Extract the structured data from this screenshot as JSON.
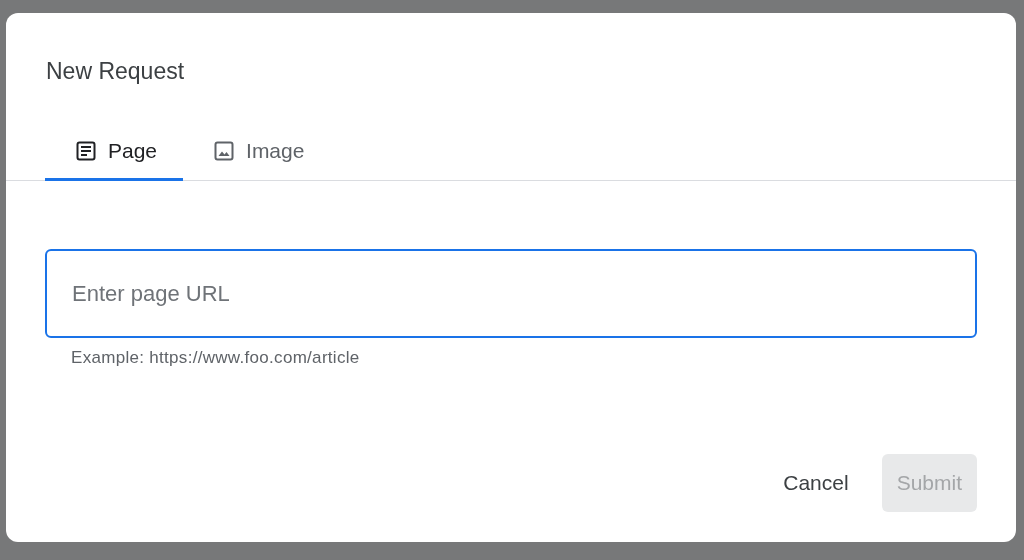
{
  "dialog": {
    "title": "New Request"
  },
  "tabs": [
    {
      "label": "Page",
      "kind": "page",
      "selected": true
    },
    {
      "label": "Image",
      "kind": "image",
      "selected": false
    }
  ],
  "url_field": {
    "placeholder": "Enter page URL",
    "focused": true,
    "helper": "Example: https://www.foo.com/article"
  },
  "buttons": [
    {
      "label": "Cancel",
      "disabled": false
    },
    {
      "label": "Submit",
      "disabled": true
    }
  ]
}
